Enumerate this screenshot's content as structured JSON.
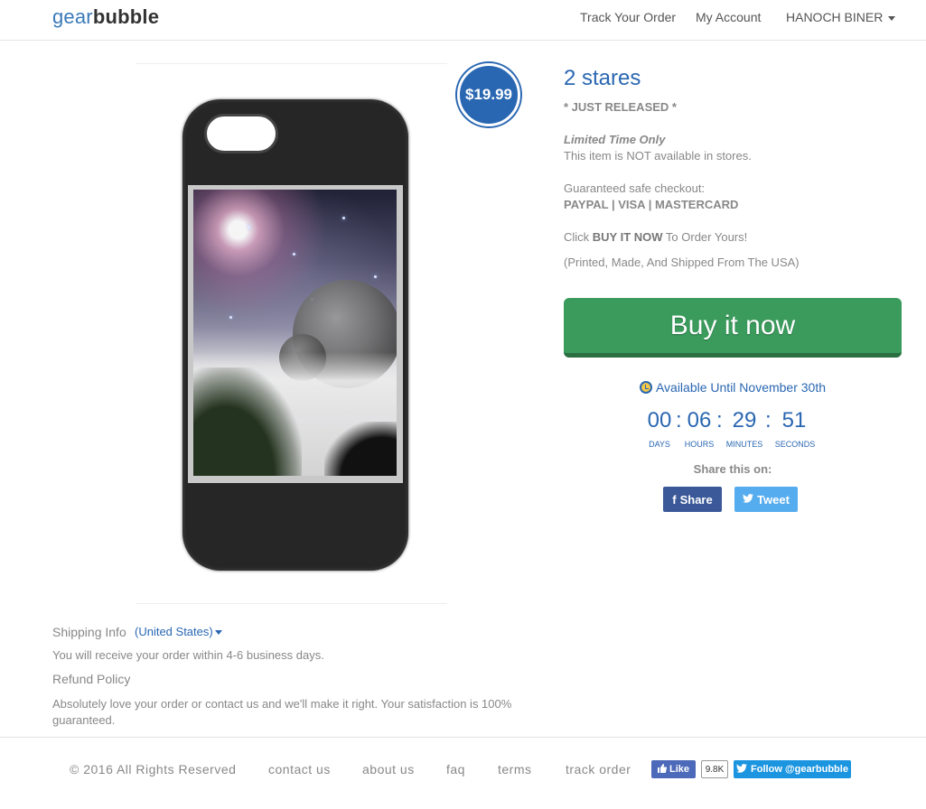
{
  "header": {
    "logo_part1": "gear",
    "logo_part2": "bubble",
    "nav": {
      "track_order": "Track Your Order",
      "my_account": "My Account",
      "user_name": "HANOCH BINER"
    }
  },
  "product": {
    "price": "$19.99",
    "title": "2 stares",
    "just_released": "* JUST RELEASED *",
    "limited_time": "Limited Time Only",
    "not_in_stores": "This item is NOT available in stores.",
    "checkout_label": "Guaranteed safe checkout:",
    "payment_methods": "PAYPAL | VISA | MASTERCARD",
    "click_prefix": "Click ",
    "click_bold": "BUY IT NOW",
    "click_suffix": " To Order Yours!",
    "origin": "(Printed, Made, And Shipped From The USA)",
    "buy_button": "Buy it now",
    "available_until": "Available Until November 30th"
  },
  "countdown": {
    "days": "00",
    "hours": "06",
    "minutes": "29",
    "seconds": "51",
    "days_label": "DAYS",
    "hours_label": "HOURS",
    "minutes_label": "MINUTES",
    "seconds_label": "SECONDS",
    "separator": ":"
  },
  "share": {
    "label": "Share this on:",
    "facebook_icon": "f",
    "facebook": "Share",
    "twitter": "Tweet"
  },
  "shipping": {
    "label": "Shipping Info",
    "country": "(United States)",
    "delivery": "You will receive your order within 4-6 business days.",
    "refund_label": "Refund Policy",
    "refund_text": "Absolutely love your order or contact us and we'll make it right. Your satisfaction is 100% guaranteed."
  },
  "footer": {
    "copyright": "© 2016 All Rights Reserved",
    "contact": "contact us",
    "about": "about us",
    "faq": "faq",
    "terms": "terms",
    "track": "track order",
    "like": "Like",
    "like_count": "9.8K",
    "follow": "Follow @gearbubble"
  },
  "icons": {
    "dropdown": "caret-down-icon",
    "clock": "clock-icon",
    "facebook": "facebook-icon",
    "twitter": "twitter-icon"
  },
  "colors": {
    "brand_blue": "#2a67b2",
    "buy_green": "#3a9b5c",
    "facebook": "#3b5998",
    "twitter": "#55acee"
  }
}
